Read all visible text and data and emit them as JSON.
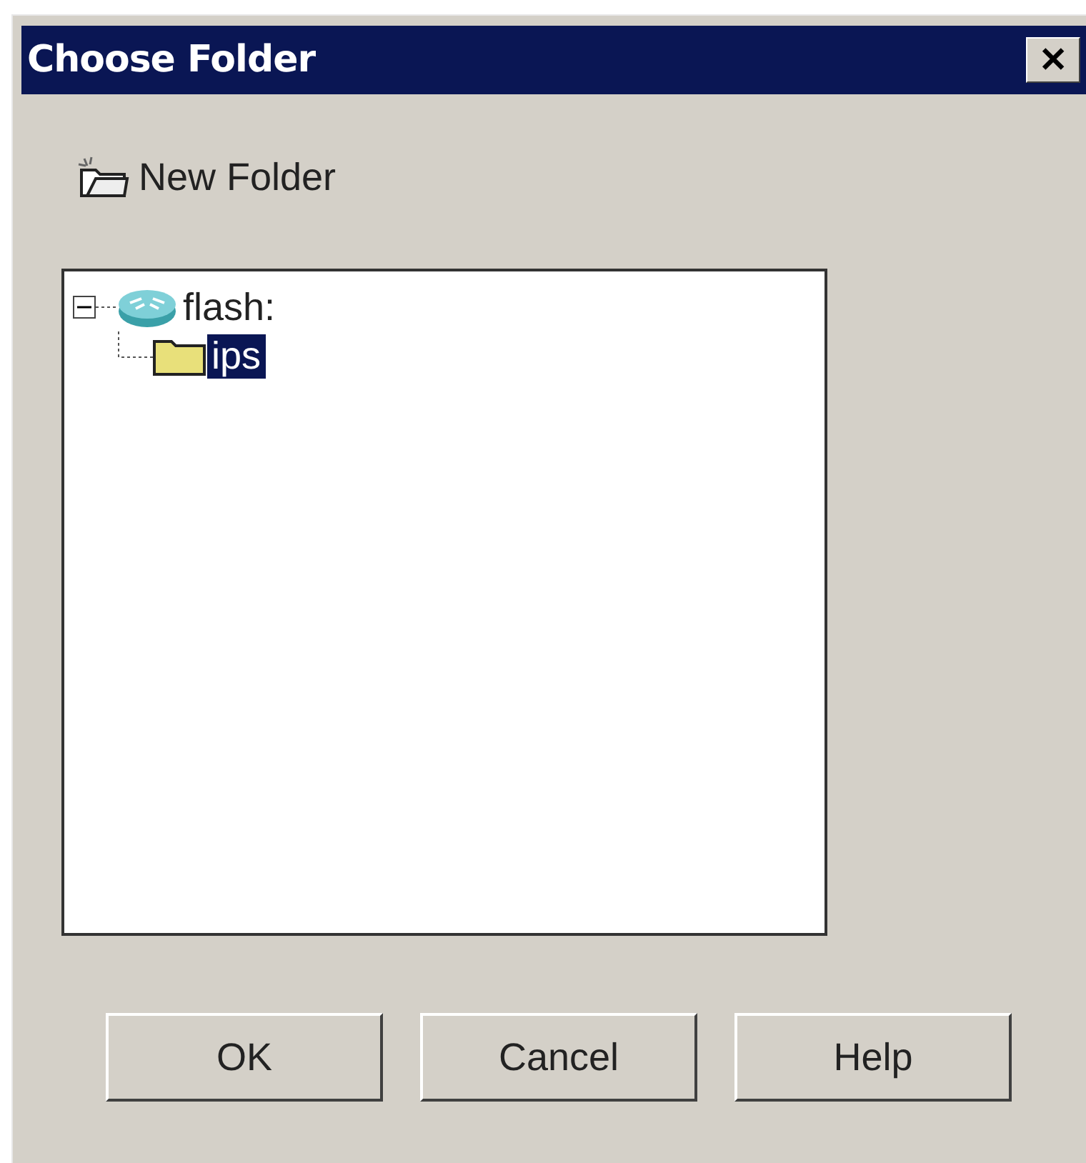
{
  "window": {
    "title": "Choose Folder",
    "close": "✕"
  },
  "toolbar": {
    "label": "New Folder"
  },
  "tree": [
    {
      "label": "flash:",
      "kind": "device",
      "expanded": true,
      "selected": false,
      "children": [
        {
          "label": "ips",
          "kind": "folder",
          "selected": true
        }
      ]
    }
  ],
  "buttons": [
    "OK",
    "Cancel",
    "Help"
  ]
}
